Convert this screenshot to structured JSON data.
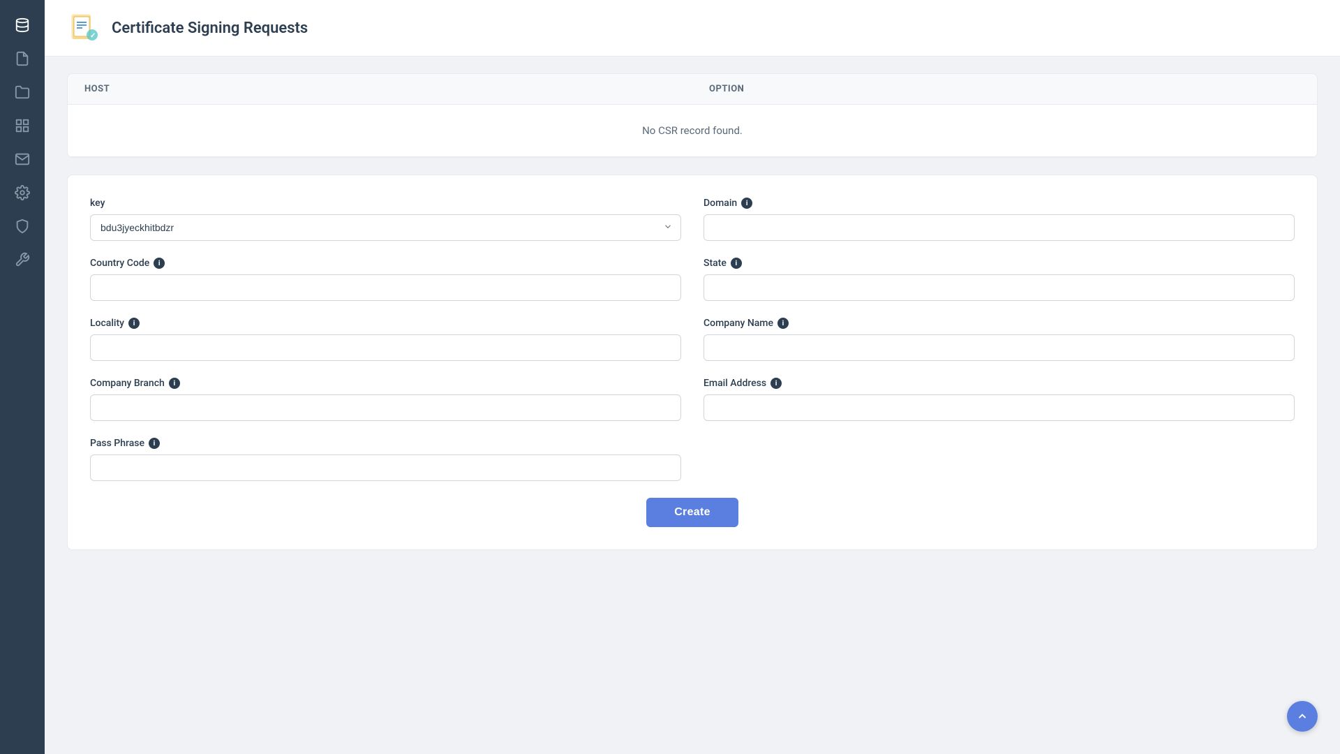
{
  "sidebar": {
    "icons": [
      {
        "name": "database-icon",
        "symbol": "⊞",
        "active": true
      },
      {
        "name": "file-icon",
        "symbol": "📄",
        "active": false
      },
      {
        "name": "folder-icon",
        "symbol": "📁",
        "active": false
      },
      {
        "name": "grid-icon",
        "symbol": "▦",
        "active": false
      },
      {
        "name": "mail-icon",
        "symbol": "✉",
        "active": false
      },
      {
        "name": "settings-icon",
        "symbol": "⚙",
        "active": false
      },
      {
        "name": "shield-icon",
        "symbol": "🛡",
        "active": false
      },
      {
        "name": "wrench-icon",
        "symbol": "🔧",
        "active": false
      }
    ]
  },
  "page": {
    "title": "Certificate Signing Requests",
    "icon_label": "csr-icon"
  },
  "table": {
    "columns": [
      "HOST",
      "OPTION"
    ],
    "empty_message": "No CSR record found."
  },
  "form": {
    "key_label": "key",
    "key_value": "bdu3jyeckhitbdzr",
    "key_options": [
      "bdu3jyeckhitbdzr"
    ],
    "domain_label": "Domain",
    "domain_info": true,
    "country_code_label": "Country Code",
    "country_code_info": true,
    "state_label": "State",
    "state_info": true,
    "locality_label": "Locality",
    "locality_info": true,
    "company_name_label": "Company Name",
    "company_name_info": true,
    "company_branch_label": "Company Branch",
    "company_branch_info": true,
    "email_address_label": "Email Address",
    "email_address_info": true,
    "pass_phrase_label": "Pass Phrase",
    "pass_phrase_info": true,
    "create_button_label": "Create"
  }
}
